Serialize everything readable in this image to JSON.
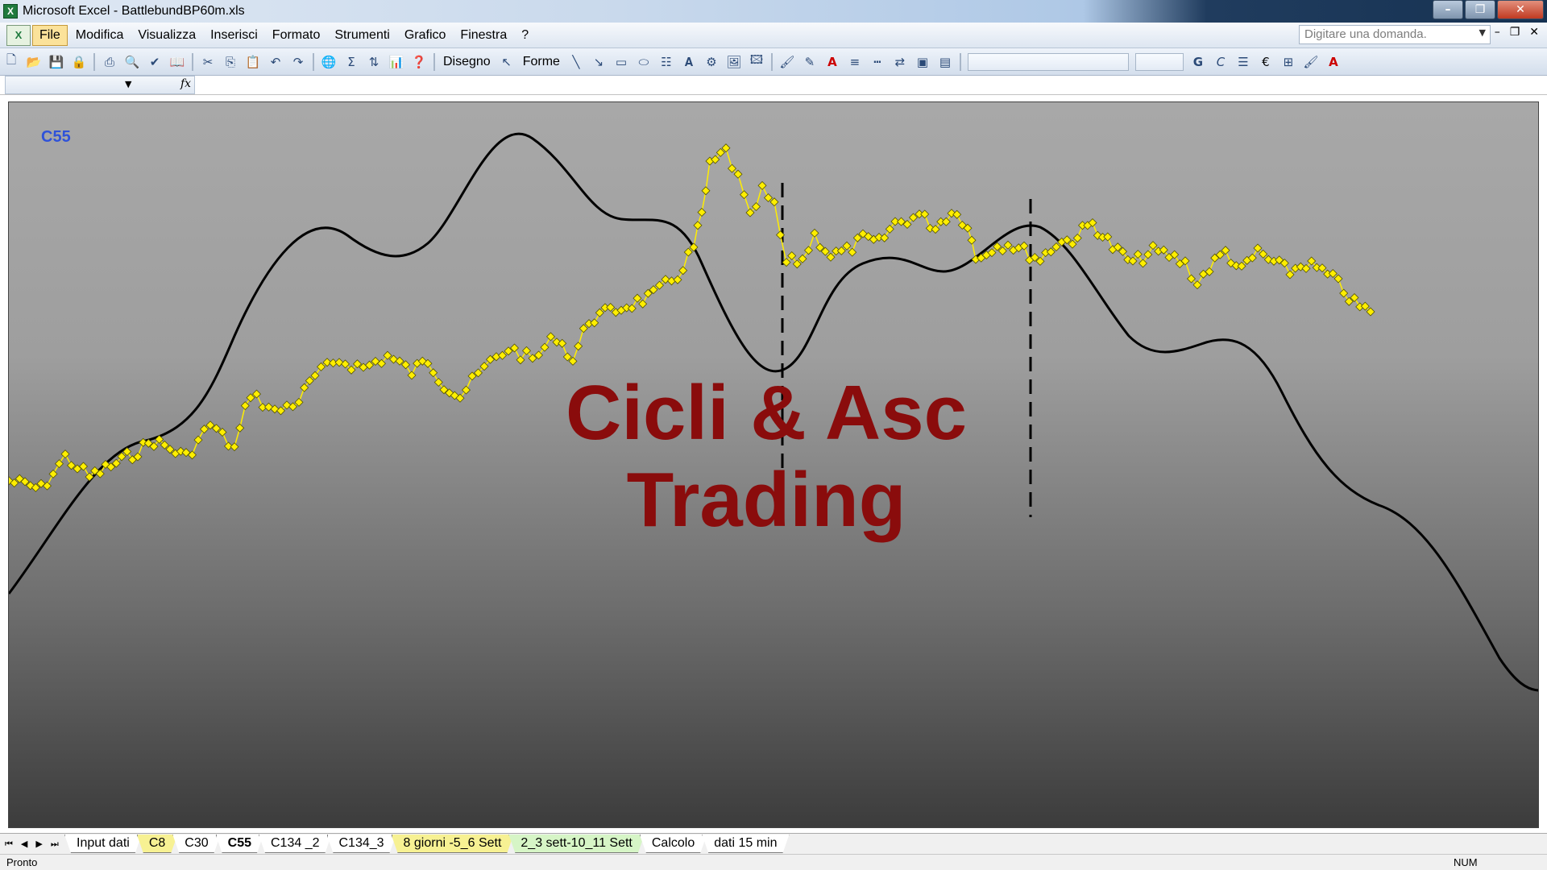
{
  "window": {
    "title": "Microsoft Excel - BattlebundBP60m.xls"
  },
  "menu": [
    {
      "label": "File",
      "active": true
    },
    {
      "label": "Modifica"
    },
    {
      "label": "Visualizza"
    },
    {
      "label": "Inserisci"
    },
    {
      "label": "Formato"
    },
    {
      "label": "Strumenti"
    },
    {
      "label": "Grafico"
    },
    {
      "label": "Finestra"
    },
    {
      "label": "?"
    }
  ],
  "ask": {
    "placeholder": "Digitare una domanda."
  },
  "toolbar": {
    "draw_label": "Disegno",
    "shapes_label": "Forme"
  },
  "chart": {
    "series_label": "C55",
    "watermark_line1": "Cicli & Asc",
    "watermark_line2": "Trading",
    "colors": {
      "price": "#ffee00",
      "cycle": "#000000",
      "watermark": "#8a0c0c",
      "label": "#2f52d9"
    }
  },
  "tabs": [
    {
      "label": "Input dati",
      "style": "plain"
    },
    {
      "label": "C8",
      "style": "yellow"
    },
    {
      "label": "C30",
      "style": "plain"
    },
    {
      "label": "C55",
      "style": "active"
    },
    {
      "label": "C134 _2",
      "style": "plain"
    },
    {
      "label": "C134_3",
      "style": "plain"
    },
    {
      "label": "8 giorni -5_6 Sett",
      "style": "yellow"
    },
    {
      "label": "2_3 sett-10_11 Sett",
      "style": "green"
    },
    {
      "label": "Calcolo",
      "style": "plain"
    },
    {
      "label": "dati 15 min",
      "style": "plain"
    }
  ],
  "status": {
    "text": "Pronto",
    "num": "NUM"
  }
}
